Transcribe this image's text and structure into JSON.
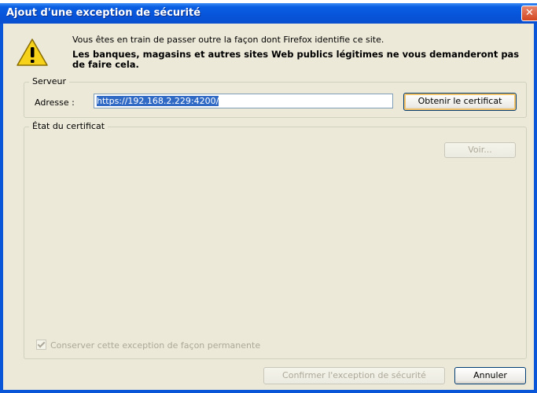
{
  "window": {
    "title": "Ajout d'une exception de sécurité",
    "close_glyph": "✕"
  },
  "warning": {
    "icon": "warning-triangle-icon",
    "line1": "Vous êtes en train de passer outre la façon dont Firefox identifie ce site.",
    "line2": "Les banques, magasins et autres sites Web publics légitimes ne vous demanderont pas de faire cela."
  },
  "server": {
    "legend": "Serveur",
    "address_label": "Adresse :",
    "address_value": "https://192.168.2.229:4200/",
    "get_certificate_button": "Obtenir le certificat"
  },
  "certificate": {
    "legend": "État du certificat",
    "view_button": "Voir...",
    "keep_permanent_label": "Conserver cette exception de façon permanente",
    "keep_permanent_checked": true
  },
  "footer": {
    "confirm_button": "Confirmer l'exception de sécurité",
    "cancel_button": "Annuler"
  },
  "colors": {
    "titlebar": "#0754d9",
    "dialog_bg": "#ece9d8",
    "selection": "#316ac5",
    "close_button": "#d2461f",
    "disabled_text": "#aca899"
  }
}
